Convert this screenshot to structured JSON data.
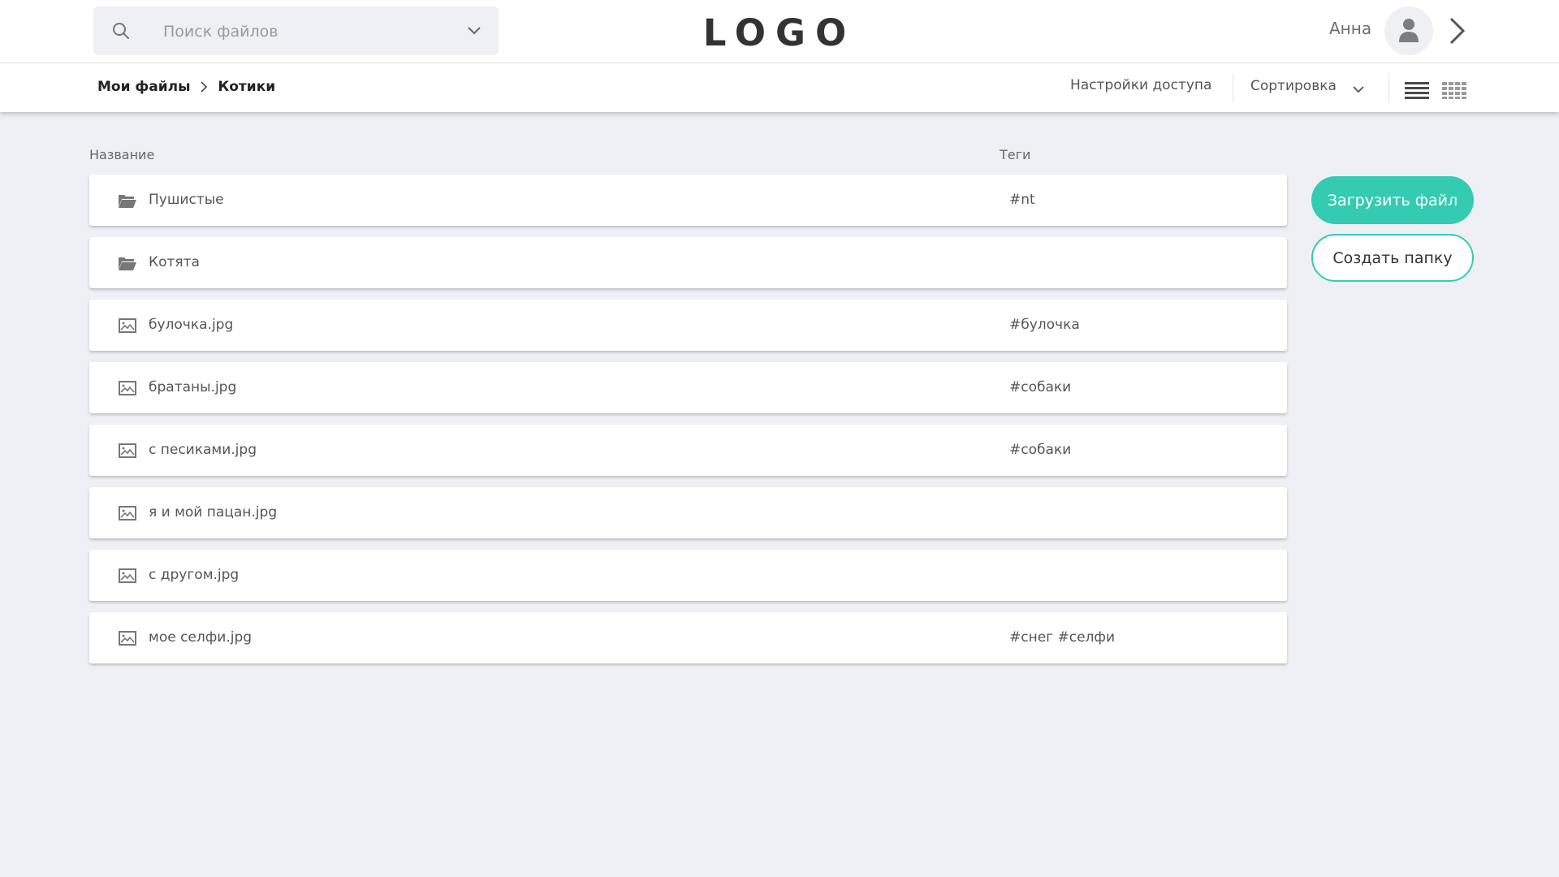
{
  "header": {
    "search_placeholder": "Поиск файлов",
    "logo": "LOGO",
    "user_name": "Анна"
  },
  "breadcrumb": {
    "root": "Мои файлы",
    "current": "Котики"
  },
  "toolbar": {
    "access_label": "Настройки доступа",
    "sort_label": "Сортировка"
  },
  "columns": {
    "name": "Название",
    "tags": "Теги"
  },
  "items": [
    {
      "type": "folder",
      "name": "Пушистые",
      "tags": "#nt"
    },
    {
      "type": "folder",
      "name": "Котята",
      "tags": ""
    },
    {
      "type": "image",
      "name": "булочка.jpg",
      "tags": "#булочка"
    },
    {
      "type": "image",
      "name": "братаны.jpg",
      "tags": "#собаки"
    },
    {
      "type": "image",
      "name": "с песиками.jpg",
      "tags": "#собаки"
    },
    {
      "type": "image",
      "name": "я и мой пацан.jpg",
      "tags": ""
    },
    {
      "type": "image",
      "name": "с другом.jpg",
      "tags": ""
    },
    {
      "type": "image",
      "name": "мое селфи.jpg",
      "tags": "#снег #селфи"
    }
  ],
  "actions": {
    "upload_label": "Загрузить файл",
    "create_folder_label": "Создать папку"
  },
  "colors": {
    "accent": "#35cbb2",
    "background": "#eff0f5"
  }
}
